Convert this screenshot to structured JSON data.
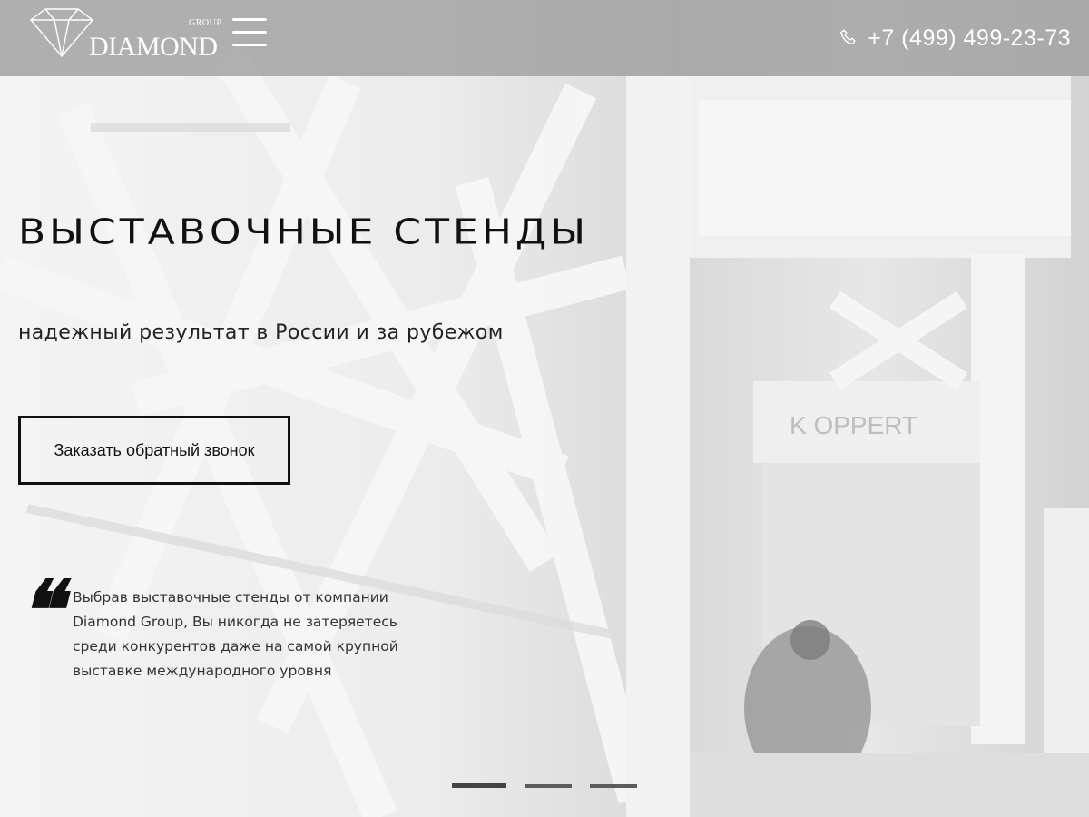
{
  "header": {
    "logo": {
      "group_label": "GROUP",
      "name": "DIAMOND"
    },
    "phone": "+7 (499) 499-23-73"
  },
  "hero": {
    "title": "ВЫСТАВОЧНЫЕ СТЕНДЫ",
    "subtitle": "надежный результат в России и за рубежом",
    "cta_label": "Заказать обратный звонок",
    "quote": "Выбрав выставочные стенды от компании Diamond Group, Вы никогда не затеряетесь среди конкурентов даже на самой крупной выставке международного уровня"
  },
  "slider": {
    "slides": 3,
    "active": 1
  },
  "colors": {
    "header_bg": "#a0a0a0",
    "text": "#111111",
    "accent": "#ffffff"
  },
  "icons": [
    "diamond-logo-icon",
    "menu-icon",
    "phone-icon",
    "quote-icon"
  ]
}
